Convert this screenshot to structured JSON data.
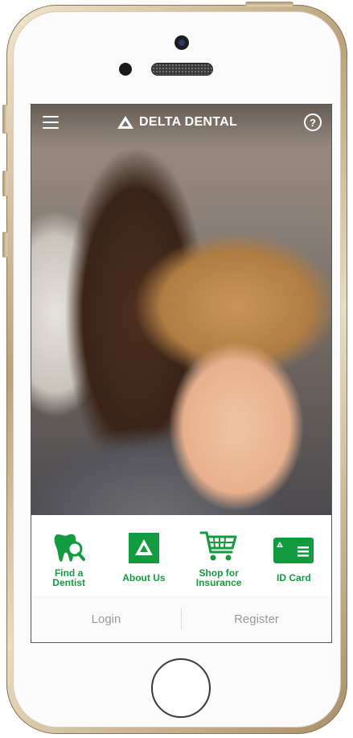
{
  "app": {
    "brand": "DELTA DENTAL",
    "menu_icon": "hamburger-menu-icon",
    "help_icon": "help-circle-icon",
    "help_glyph": "?"
  },
  "actions": [
    {
      "label_line1": "Find a",
      "label_line2": "Dentist",
      "icon": "tooth-search-icon"
    },
    {
      "label": "About Us",
      "icon": "delta-logo-icon"
    },
    {
      "label_line1": "Shop for",
      "label_line2": "Insurance",
      "icon": "shopping-cart-icon"
    },
    {
      "label": "ID Card",
      "icon": "id-card-icon"
    }
  ],
  "footer": {
    "login": "Login",
    "register": "Register"
  },
  "colors": {
    "brand_green": "#139b3f",
    "footer_text": "#9a9a9a"
  }
}
